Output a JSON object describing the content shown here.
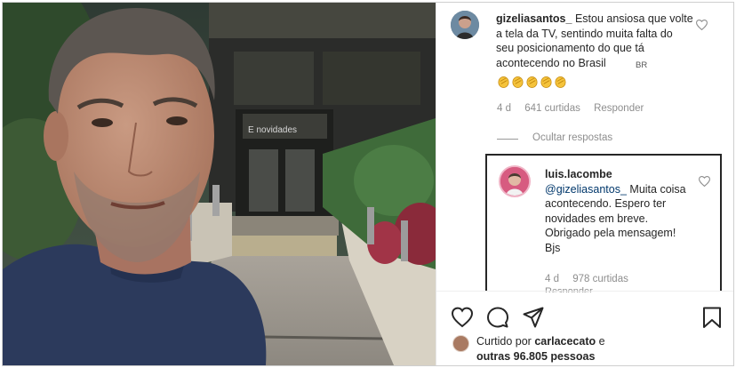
{
  "comment": {
    "username": "gizeliasantos_",
    "text": "Estou ansiosa que volte a tela da TV, sentindo muita falta do seu posicionamento do que tá acontecendo no Brasil",
    "flag": "BR",
    "emoji_count": 5,
    "age": "4 d",
    "likes": "641 curtidas",
    "reply_label": "Responder",
    "hide_replies": "Ocultar respostas"
  },
  "reply": {
    "username": "luis.lacombe",
    "mention": "@gizeliasantos_",
    "text": "Muita coisa acontecendo. Espero ter novidades em breve. Obrigado pela mensagem! Bjs",
    "age": "4 d",
    "likes": "978 curtidas",
    "reply_label": "Responder"
  },
  "liked_by": {
    "prefix": "Curtido por",
    "user": "carlacecato",
    "suffix": "e",
    "others": "outras 96.805 pessoas"
  },
  "photo": {
    "building_sign": "E novidades"
  },
  "colors": {
    "text": "#262626",
    "muted": "#8e8e8e",
    "mention": "#00376b",
    "border": "#262626"
  },
  "icons": [
    "heart-icon",
    "comment-icon",
    "share-icon",
    "save-icon"
  ]
}
